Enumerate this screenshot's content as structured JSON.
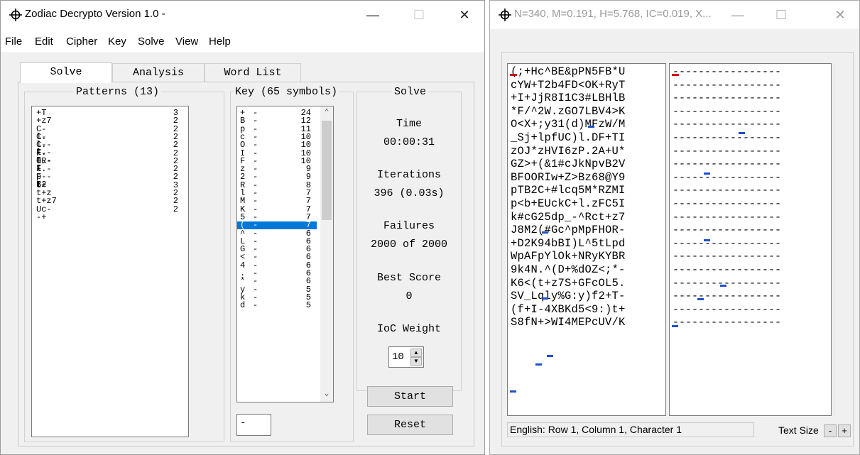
{
  "main_window": {
    "title": "Zodiac Decrypto Version 1.0 -",
    "controls": {
      "minimize": "—",
      "maximize": "☐",
      "close": "✕"
    },
    "menu": [
      "File",
      "Edit",
      "Cipher",
      "Key",
      "Solve",
      "View",
      "Help"
    ],
    "tabs": [
      "Solve",
      "Analysis",
      "Word List"
    ],
    "patterns": {
      "title": "Patterns (13)",
      "rows": [
        {
          "pattern": "+T",
          "count": "3"
        },
        {
          "pattern": "+z7",
          "count": "2"
        },
        {
          "pattern": "C-l.",
          "count": "2"
        },
        {
          "pattern": "C-l.-F",
          "count": "2"
        },
        {
          "pattern": "C-l.-F--I",
          "count": "2"
        },
        {
          "pattern": "F-OR",
          "count": "2"
        },
        {
          "pattern": "l.-F",
          "count": "2"
        },
        {
          "pattern": "l.-F--I",
          "count": "2"
        },
        {
          "pattern": "p-B2",
          "count": "2"
        },
        {
          "pattern": "t+",
          "count": "3"
        },
        {
          "pattern": "t+z",
          "count": "2"
        },
        {
          "pattern": "t+z7",
          "count": "2"
        },
        {
          "pattern": "Uc--+",
          "count": "2"
        }
      ]
    },
    "key": {
      "title": "Key (65 symbols)",
      "rows": [
        {
          "symbol": "+",
          "mapped": "-",
          "count": "24"
        },
        {
          "symbol": "B",
          "mapped": "-",
          "count": "12"
        },
        {
          "symbol": "p",
          "mapped": "-",
          "count": "11"
        },
        {
          "symbol": "c",
          "mapped": "-",
          "count": "10"
        },
        {
          "symbol": "O",
          "mapped": "-",
          "count": "10"
        },
        {
          "symbol": "I",
          "mapped": "-",
          "count": "10"
        },
        {
          "symbol": "F",
          "mapped": "-",
          "count": "10"
        },
        {
          "symbol": "z",
          "mapped": "-",
          "count": "9"
        },
        {
          "symbol": "2",
          "mapped": "-",
          "count": "9"
        },
        {
          "symbol": "R",
          "mapped": "-",
          "count": "8"
        },
        {
          "symbol": "l",
          "mapped": "-",
          "count": "7"
        },
        {
          "symbol": "M",
          "mapped": "-",
          "count": "7"
        },
        {
          "symbol": "K",
          "mapped": "-",
          "count": "7"
        },
        {
          "symbol": "5",
          "mapped": "-",
          "count": "7"
        },
        {
          "symbol": "(",
          "mapped": "-",
          "count": "7"
        },
        {
          "symbol": "^",
          "mapped": "-",
          "count": "6"
        },
        {
          "symbol": "L",
          "mapped": "-",
          "count": "6"
        },
        {
          "symbol": "G",
          "mapped": "-",
          "count": "6"
        },
        {
          "symbol": "<",
          "mapped": "-",
          "count": "6"
        },
        {
          "symbol": "4",
          "mapped": "-",
          "count": "6"
        },
        {
          "symbol": ".",
          "mapped": "-",
          "count": "6"
        },
        {
          "symbol": "*",
          "mapped": "-",
          "count": "6"
        },
        {
          "symbol": "y",
          "mapped": "-",
          "count": "5"
        },
        {
          "symbol": "k",
          "mapped": "-",
          "count": "5"
        },
        {
          "symbol": "d",
          "mapped": "-",
          "count": "5"
        }
      ],
      "selected_index": 14,
      "edit_value": "-"
    },
    "solve": {
      "title": "Solve",
      "time_label": "Time",
      "time_value": "00:00:31",
      "iterations_label": "Iterations",
      "iterations_value": "396 (0.03s)",
      "failures_label": "Failures",
      "failures_value": "2000 of 2000",
      "best_score_label": "Best Score",
      "best_score_value": "0",
      "ioc_label": "IoC Weight",
      "ioc_value": "10",
      "start_label": "Start",
      "reset_label": "Reset"
    }
  },
  "cipher_window": {
    "title": "N=340, M=0.191, H=5.768, IC=0.019, X...",
    "controls": {
      "minimize": "—",
      "maximize": "☐",
      "close": "✕"
    },
    "cipher_lines": [
      "(;+Hc^BE&pPN5FB*U",
      "cYW+T2b4FD<OK+RyT",
      "+I+JjR8I1C3#LBHlB",
      "*F/^2W.zGO7LBV4>K",
      "O<X+;y31(d)MFzW/M",
      "_Sj+lpfUC)l.DF+TI",
      "zOJ*zHVI6zP.2A+U*",
      "GZ>+(&1#cJkNpvB2V",
      "BFOORIw+Z>Bz68@Y9",
      "pTB2C+#lcq5M*RZMI",
      "p<b+EUckC+l.zFC5I",
      "k#cG25dp_-^Rct+z7",
      "J8M2(#Gc^pMpFHOR-",
      "+D2K94bBI)L^5tLpd",
      "WpAFpYlOk+NRyKYBR",
      "9k4N.^(D+%dOZ<;*-",
      "K6<(t+z7S+GFcOL5.",
      "SV_Lqly%G:y)f2+T-",
      "(f+I-4XBKd5<9:)t+",
      "S8fN+>WI4MEPcUV/K"
    ],
    "plaintext_line": "-----------------",
    "status": "English: Row 1, Column 1, Character 1",
    "text_size_label": "Text Size",
    "text_size_minus": "-",
    "text_size_plus": "+"
  }
}
